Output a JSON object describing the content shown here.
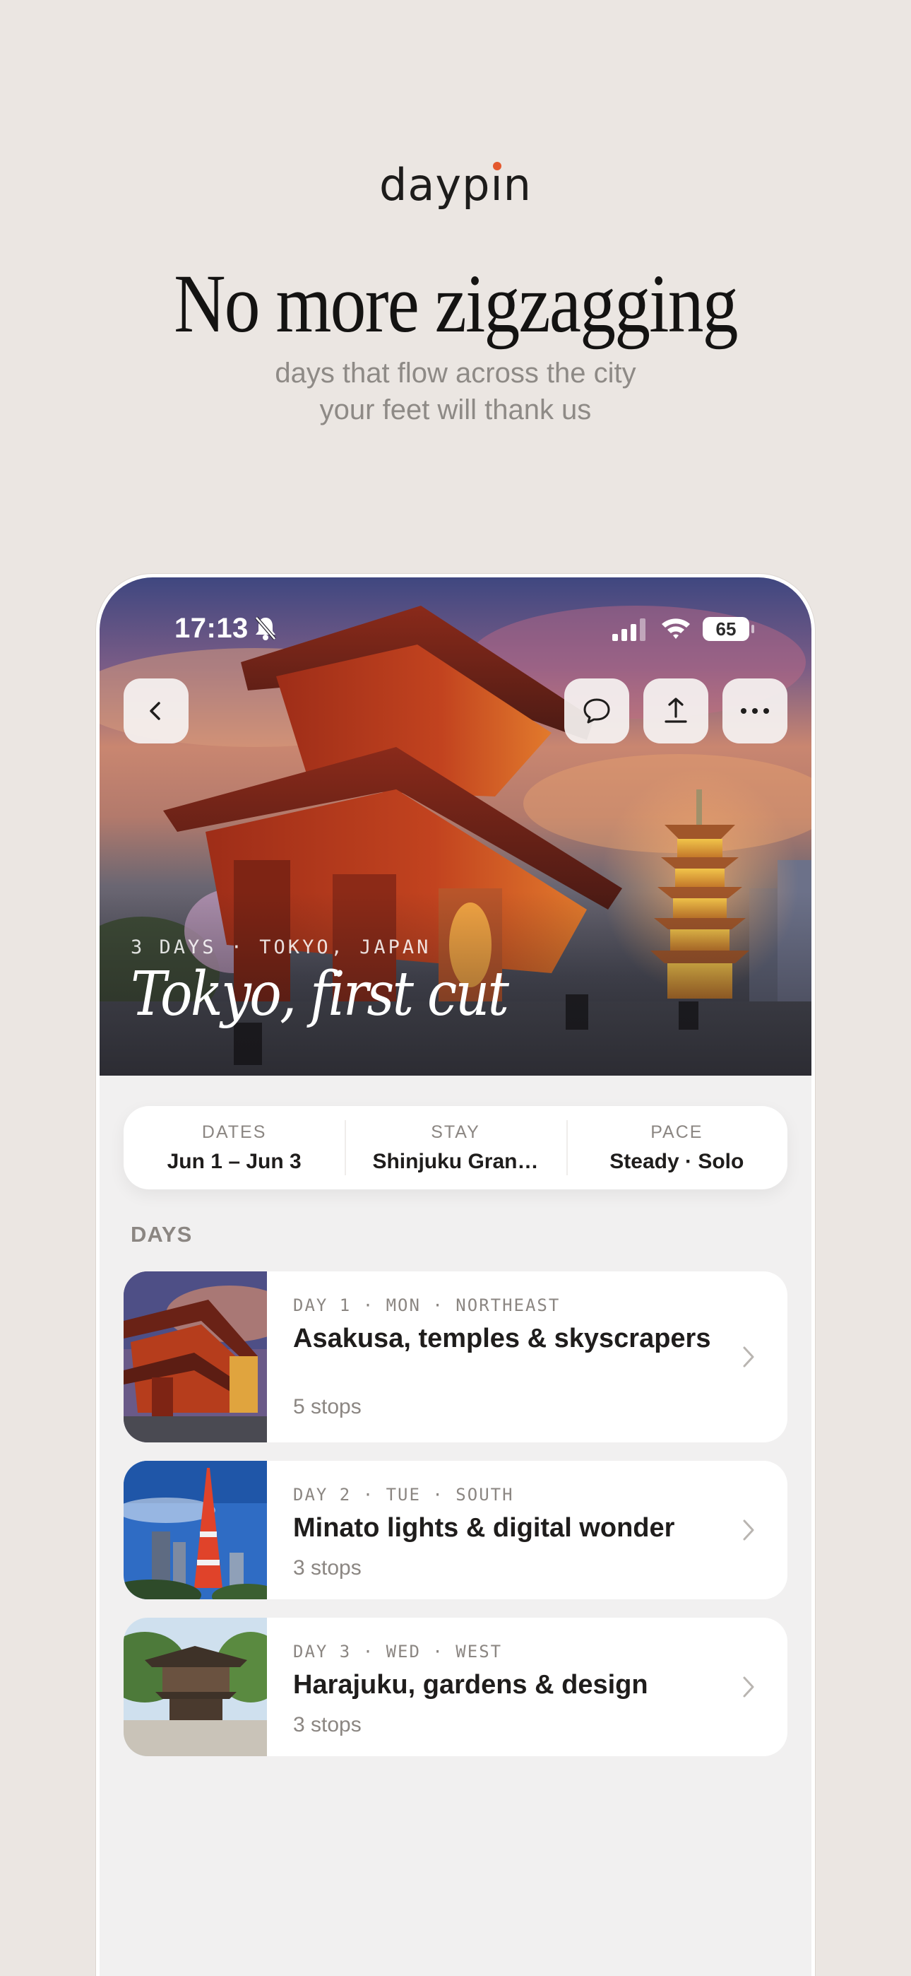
{
  "brand": {
    "name_pre": "dayp",
    "name_i": "ı",
    "name_post": "n",
    "accent_color": "#e4582d"
  },
  "headline": "No more zigzagging",
  "subline": [
    "days that flow across the city",
    "your feet will thank us"
  ],
  "status_bar": {
    "time": "17:13",
    "battery": "65",
    "icons": [
      "bell-slash-icon",
      "signal-icon",
      "wifi-icon",
      "battery-icon"
    ]
  },
  "hero": {
    "eyebrow": "3 DAYS · TOKYO, JAPAN",
    "title": "Tokyo, first cut",
    "buttons": [
      "back-icon",
      "chat-icon",
      "share-icon",
      "more-icon"
    ]
  },
  "trip_info": [
    {
      "label": "DATES",
      "value": "Jun 1 – Jun 3"
    },
    {
      "label": "STAY",
      "value": "Shinjuku Gran…"
    },
    {
      "label": "PACE",
      "value": "Steady · Solo"
    }
  ],
  "days_heading": "DAYS",
  "days": [
    {
      "meta": "DAY 1 · MON · NORTHEAST",
      "title": "Asakusa, temples & skyscrapers",
      "stops": "5 stops",
      "thumb": "temple-photo"
    },
    {
      "meta": "DAY 2 · TUE · SOUTH",
      "title": "Minato lights & digital wonder",
      "stops": "3 stops",
      "thumb": "tokyo-tower-photo"
    },
    {
      "meta": "DAY 3 · WED · WEST",
      "title": "Harajuku, gardens & design",
      "stops": "3 stops",
      "thumb": "shrine-photo"
    }
  ]
}
